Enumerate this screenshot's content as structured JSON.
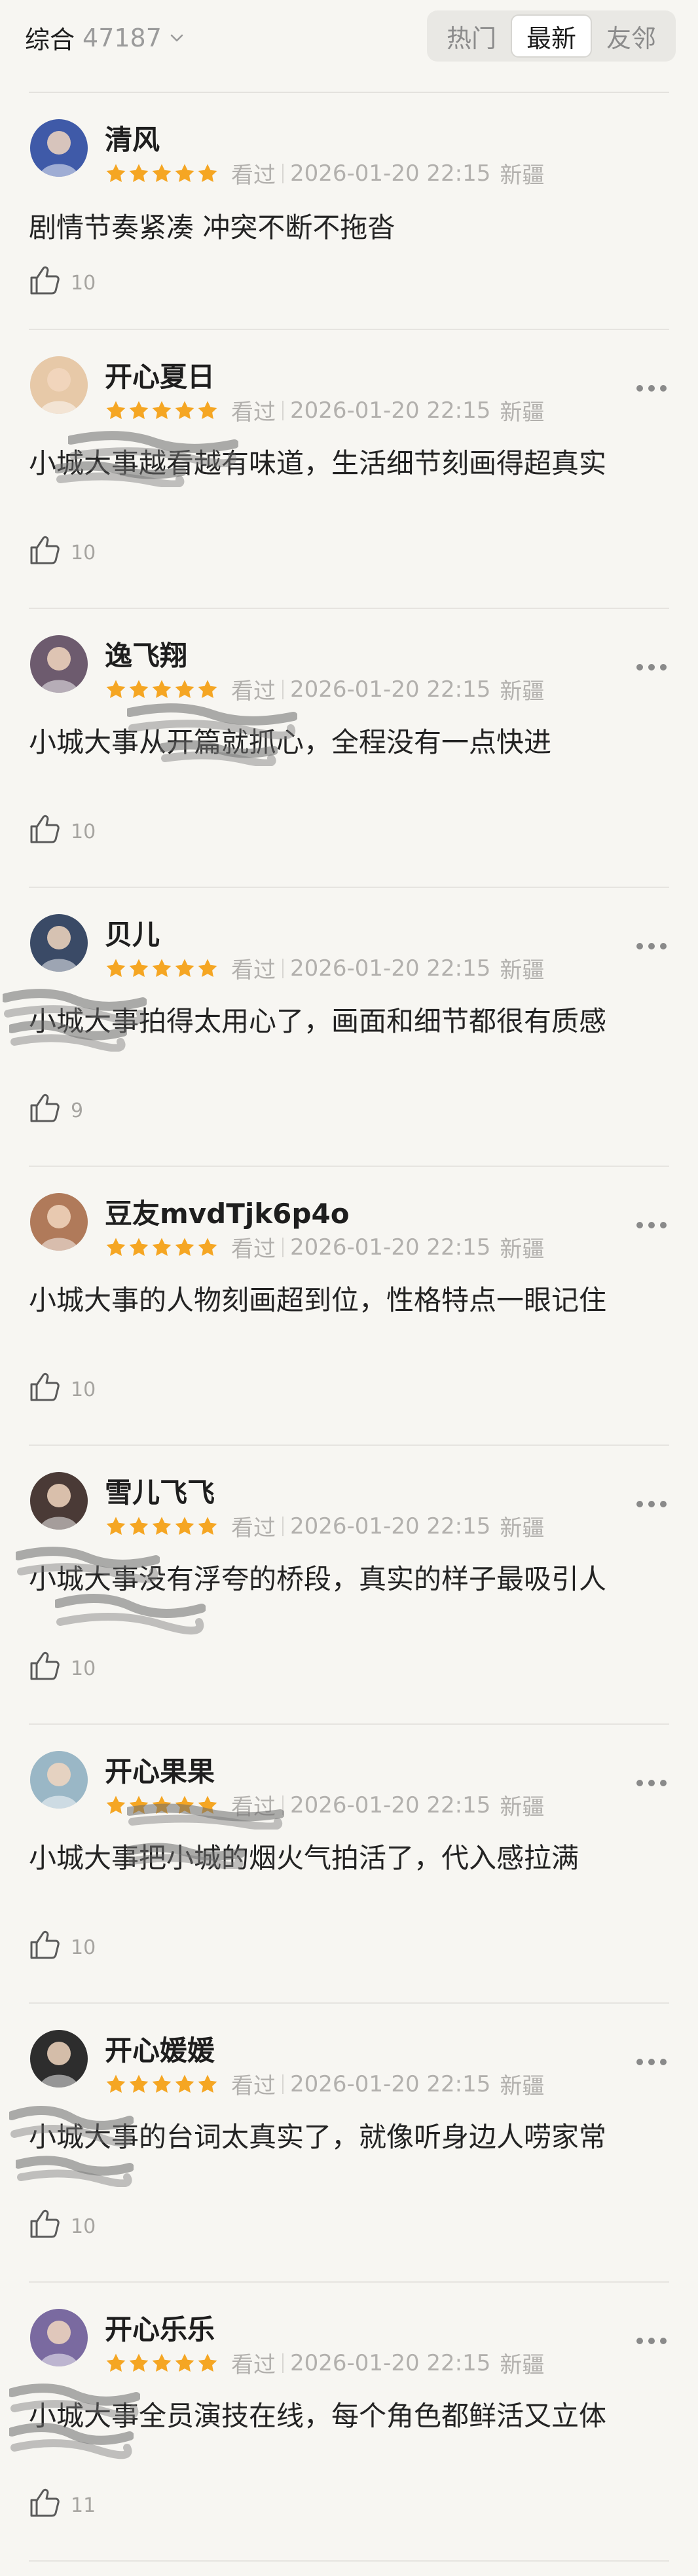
{
  "header": {
    "filter_label": "综合",
    "filter_count": "47187",
    "tabs": [
      {
        "label": "热门",
        "active": false
      },
      {
        "label": "最新",
        "active": true
      },
      {
        "label": "友邻",
        "active": false
      }
    ]
  },
  "meta_labels": {
    "watched": "看过"
  },
  "comments": [
    {
      "user": "清风",
      "rating": 5,
      "status": "看过",
      "time": "2026-01-20 22:15",
      "location": "新疆",
      "text": "剧情节奏紧凑 冲突不断不拖沓",
      "likes": "10",
      "show_more": false,
      "avatar_color": "#3f5aa8"
    },
    {
      "user": "开心夏日",
      "rating": 5,
      "status": "看过",
      "time": "2026-01-20 22:15",
      "location": "新疆",
      "text": "小城大事越看越有味道，生活细节刻画得超真实",
      "likes": "10",
      "show_more": true,
      "avatar_color": "#e7c9a8"
    },
    {
      "user": "逸飞翔",
      "rating": 5,
      "status": "看过",
      "time": "2026-01-20 22:15",
      "location": "新疆",
      "text": "小城大事从开篇就抓心，全程没有一点快进",
      "likes": "10",
      "show_more": true,
      "avatar_color": "#6d5b6e"
    },
    {
      "user": "贝儿",
      "rating": 5,
      "status": "看过",
      "time": "2026-01-20 22:15",
      "location": "新疆",
      "text": "小城大事拍得太用心了，画面和细节都很有质感",
      "likes": "9",
      "show_more": true,
      "avatar_color": "#3a4a66"
    },
    {
      "user": "豆友mvdTjk6p4o",
      "rating": 5,
      "status": "看过",
      "time": "2026-01-20 22:15",
      "location": "新疆",
      "text": "小城大事的人物刻画超到位，性格特点一眼记住",
      "likes": "10",
      "show_more": true,
      "avatar_color": "#b07a5a"
    },
    {
      "user": "雪儿飞飞",
      "rating": 5,
      "status": "看过",
      "time": "2026-01-20 22:15",
      "location": "新疆",
      "text": "小城大事没有浮夸的桥段，真实的样子最吸引人",
      "likes": "10",
      "show_more": true,
      "avatar_color": "#4a3a36"
    },
    {
      "user": "开心果果",
      "rating": 5,
      "status": "看过",
      "time": "2026-01-20 22:15",
      "location": "新疆",
      "text": "小城大事把小城的烟火气拍活了，代入感拉满",
      "likes": "10",
      "show_more": true,
      "avatar_color": "#9ab7c6"
    },
    {
      "user": "开心媛媛",
      "rating": 5,
      "status": "看过",
      "time": "2026-01-20 22:15",
      "location": "新疆",
      "text": "小城大事的台词太真实了，就像听身边人唠家常",
      "likes": "10",
      "show_more": true,
      "avatar_color": "#2d2d2d"
    },
    {
      "user": "开心乐乐",
      "rating": 5,
      "status": "看过",
      "time": "2026-01-20 22:15",
      "location": "新疆",
      "text": "小城大事全员演技在线，每个角色都鲜活又立体",
      "likes": "11",
      "show_more": true,
      "avatar_color": "#7a6aa0"
    }
  ],
  "colors": {
    "star": "#f5a623",
    "background": "#f7f6f2",
    "muted": "#b2b0ad"
  }
}
